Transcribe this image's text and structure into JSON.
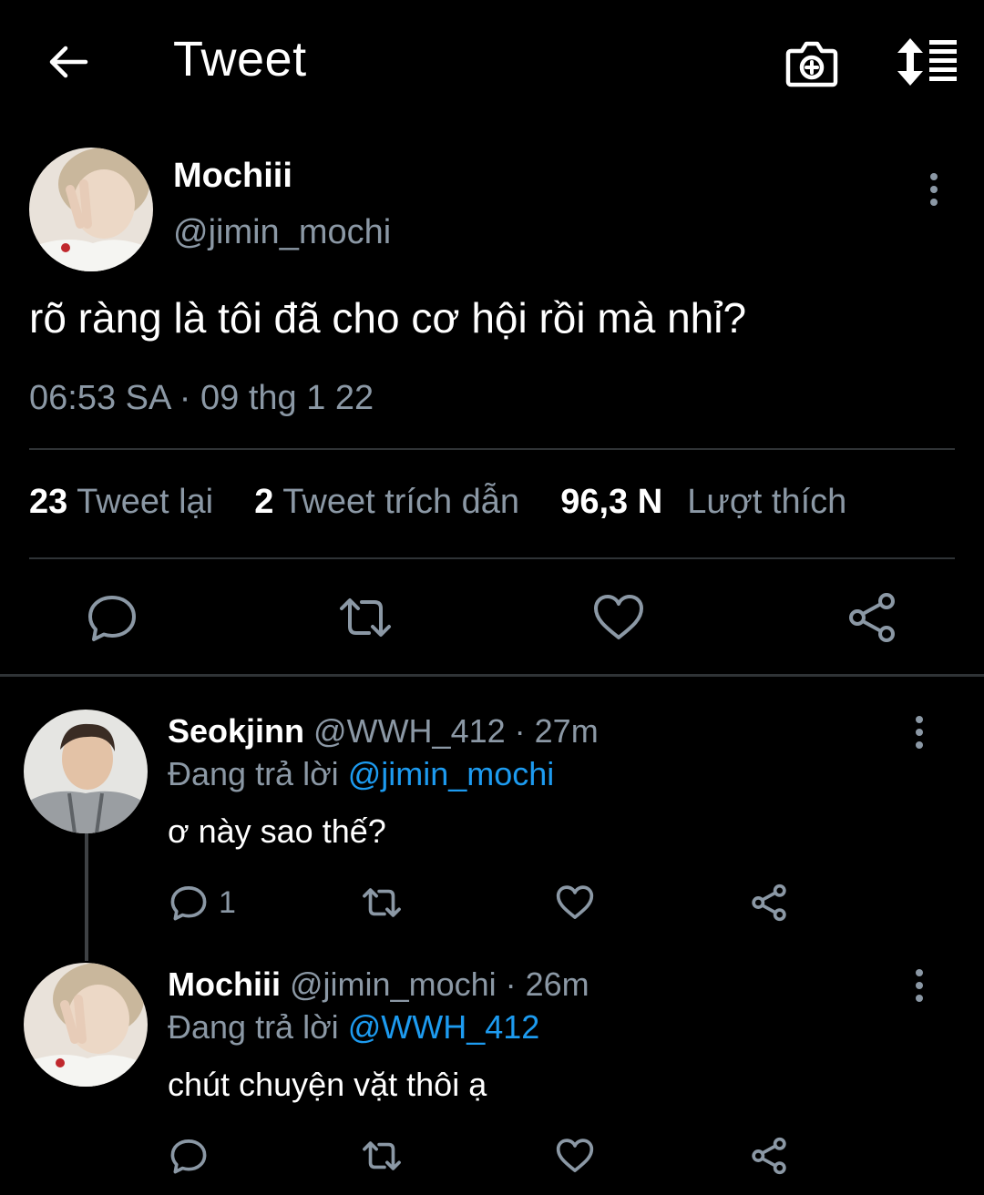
{
  "header": {
    "title": "Tweet",
    "back_icon": "arrow-left-icon",
    "camera_icon": "camera-plus-icon",
    "sort_icon": "sort-list-icon"
  },
  "main_tweet": {
    "name": "Mochiii",
    "handle": "@jimin_mochi",
    "text": "rõ ràng là tôi đã cho cơ hội rồi mà nhỉ?",
    "timestamp": "06:53 SA · 09 thg 1 22",
    "stats": {
      "retweets_count": "23",
      "retweets_label": "Tweet lại",
      "quotes_count": "2",
      "quotes_label": "Tweet trích dẫn",
      "likes_count": "96,3 N",
      "likes_label": "Lượt thích"
    }
  },
  "replies": [
    {
      "name": "Seokjinn",
      "handle": "@WWH_412",
      "time": "· 27m",
      "replying_prefix": "Đang trả lời",
      "replying_to": "@jimin_mochi",
      "text": "ơ này sao thế?",
      "reply_count": "1"
    },
    {
      "name": "Mochiii",
      "handle": "@jimin_mochi",
      "time": "· 26m",
      "replying_prefix": "Đang trả lời",
      "replying_to": "@WWH_412",
      "text": "chút chuyện vặt thôi ạ",
      "reply_count": ""
    }
  ],
  "colors": {
    "background": "#000000",
    "secondary_text": "#8b98a5",
    "link": "#1d9bf0",
    "divider": "#2f3336"
  }
}
